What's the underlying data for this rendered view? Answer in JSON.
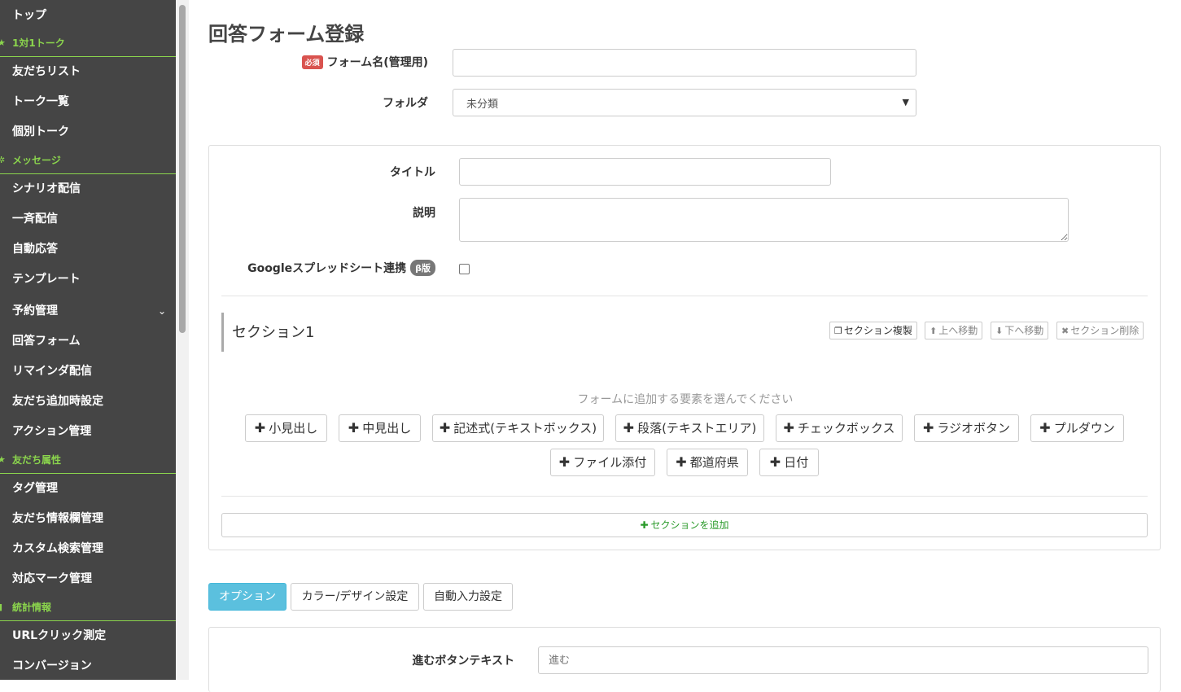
{
  "sidebar": {
    "items": [
      {
        "type": "item",
        "label": "トップ"
      },
      {
        "type": "section",
        "label": "1対1トーク",
        "icon": "star-icon"
      },
      {
        "type": "item",
        "label": "友だちリスト"
      },
      {
        "type": "item",
        "label": "トーク一覧"
      },
      {
        "type": "item",
        "label": "個別トーク"
      },
      {
        "type": "section",
        "label": "メッセージ",
        "icon": "sparkle-icon"
      },
      {
        "type": "item",
        "label": "シナリオ配信"
      },
      {
        "type": "item",
        "label": "一斉配信"
      },
      {
        "type": "item",
        "label": "自動応答"
      },
      {
        "type": "item",
        "label": "テンプレート"
      },
      {
        "type": "item",
        "label": "予約管理",
        "chevron": "chevron-down-icon"
      },
      {
        "type": "item",
        "label": "回答フォーム"
      },
      {
        "type": "item",
        "label": "リマインダ配信"
      },
      {
        "type": "item",
        "label": "友だち追加時設定"
      },
      {
        "type": "item",
        "label": "アクション管理"
      },
      {
        "type": "section",
        "label": "友だち属性",
        "icon": "star-icon"
      },
      {
        "type": "item",
        "label": "タグ管理"
      },
      {
        "type": "item",
        "label": "友だち情報欄管理"
      },
      {
        "type": "item",
        "label": "カスタム検索管理"
      },
      {
        "type": "item",
        "label": "対応マーク管理"
      },
      {
        "type": "section",
        "label": "統計情報",
        "icon": "chart-icon"
      },
      {
        "type": "item",
        "label": "URLクリック測定"
      },
      {
        "type": "item",
        "label": "コンバージョン"
      }
    ]
  },
  "page": {
    "title": "回答フォーム登録",
    "form_name_label": "フォーム名(管理用)",
    "required_badge": "必須",
    "form_name_value": "",
    "folder_label": "フォルダ",
    "folder_selected": "未分類"
  },
  "form_panel": {
    "title_label": "タイトル",
    "title_value": "",
    "desc_label": "説明",
    "desc_value": "",
    "gsheet_label": "Googleスプレッドシート連携",
    "beta_badge": "β版",
    "gsheet_checked": false
  },
  "section": {
    "title": "セクション1",
    "copy_btn": "セクション複製",
    "up_btn": "上へ移動",
    "down_btn": "下へ移動",
    "delete_btn": "セクション削除",
    "hint": "フォームに追加する要素を選んでください",
    "elements": [
      "小見出し",
      "中見出し",
      "記述式(テキストボックス)",
      "段落(テキストエリア)",
      "チェックボックス",
      "ラジオボタン",
      "プルダウン",
      "ファイル添付",
      "都道府県",
      "日付"
    ],
    "add_section": "セクションを追加"
  },
  "tabs": [
    "オプション",
    "カラー/デザイン設定",
    "自動入力設定"
  ],
  "options": {
    "next_btn_label": "進むボタンテキスト",
    "next_btn_placeholder": "進む"
  },
  "colors": {
    "sidebar_bg": "#454545",
    "sidebar_accent": "#8bd54d",
    "tab_active": "#5bc0de",
    "required": "#d9534f"
  }
}
